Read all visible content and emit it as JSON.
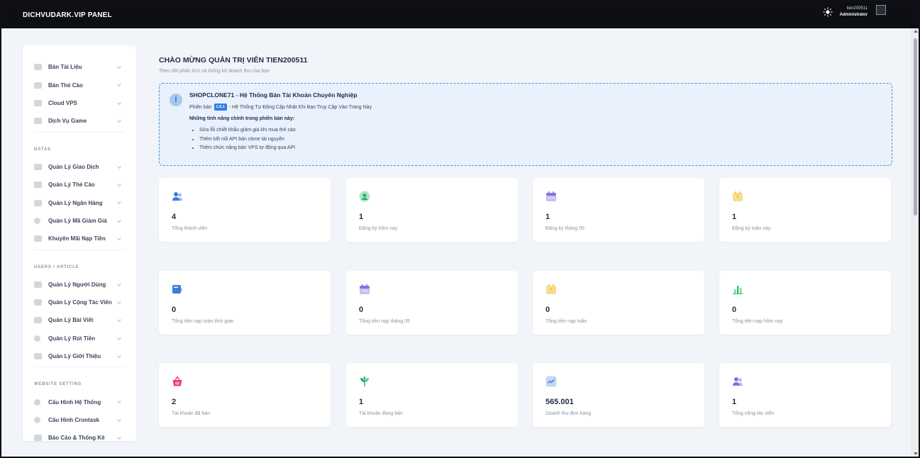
{
  "header": {
    "brand": "DICHVUDARK.VIP PANEL",
    "user_name": "tien200511",
    "user_role": "Administrator"
  },
  "sidebar": {
    "group1": [
      {
        "label": "Bán Tài Liệu",
        "icon": "document-icon"
      },
      {
        "label": "Bán Thẻ Cào",
        "icon": "card-icon"
      },
      {
        "label": "Cloud VPS",
        "icon": "cloud-icon"
      },
      {
        "label": "Dịch Vụ Game",
        "icon": "game-icon"
      }
    ],
    "section_data": "DATAS",
    "group2": [
      {
        "label": "Quản Lý Giao Dịch",
        "icon": "transaction-icon"
      },
      {
        "label": "Quản Lý Thẻ Cào",
        "icon": "card-icon"
      },
      {
        "label": "Quản Lý Ngân Hàng",
        "icon": "bank-icon"
      },
      {
        "label": "Quản Lý Mã Giảm Giá",
        "icon": "discount-icon"
      },
      {
        "label": "Khuyến Mãi Nạp Tiền",
        "icon": "promotion-icon"
      }
    ],
    "section_users": "USERS / ARTICLE",
    "group3": [
      {
        "label": "Quản Lý Người Dùng",
        "icon": "users-icon"
      },
      {
        "label": "Quản Lý Cộng Tác Viên",
        "icon": "partner-icon"
      },
      {
        "label": "Quản Lý Bài Viết",
        "icon": "article-icon"
      },
      {
        "label": "Quản Lý Rút Tiền",
        "icon": "withdraw-icon"
      },
      {
        "label": "Quản Lý Giới Thiệu",
        "icon": "referral-icon"
      }
    ],
    "section_website": "WEBSITE SETTING",
    "group4": [
      {
        "label": "Cấu Hình Hệ Thống",
        "icon": "settings-icon"
      },
      {
        "label": "Cấu Hình Crontask",
        "icon": "clock-icon"
      },
      {
        "label": "Báo Cáo & Thống Kê",
        "icon": "report-icon"
      }
    ]
  },
  "main": {
    "welcome_title": "CHÀO MỪNG QUẢN TRỊ VIÊN TIEN200511",
    "welcome_sub": "Theo dõi phân tích và thống kê doanh thu của bạn",
    "notice": {
      "title": "SHOPCLONE71 - Hệ Thống Bán Tài Khoản Chuyên Nghiệp",
      "version_prefix": "Phiên bản",
      "version": "1.6.1",
      "version_suffix": "- Hệ Thống Tự Động Cập Nhật Khi Bạn Truy Cập Vào Trang Này",
      "features_title": "Những tính năng chính trong phiên bản này:",
      "features": [
        "Sửa lỗi chiết khấu giảm giá khi mua thẻ cào",
        "Thêm kết nối API bán clone tài nguyên",
        "Thêm chức năng bán VPS tự động qua API"
      ]
    },
    "cards": [
      {
        "value": "4",
        "label": "Tổng thành viên",
        "icon": "users-icon",
        "color": "#3b7ddd"
      },
      {
        "value": "1",
        "label": "Đăng ký hôm nay",
        "icon": "user-icon",
        "color": "#1fb36b"
      },
      {
        "value": "1",
        "label": "Đăng ký tháng 05",
        "icon": "calendar-icon",
        "color": "#8b6fe0"
      },
      {
        "value": "1",
        "label": "Đăng ký tuần này",
        "icon": "calendar-week-icon",
        "color": "#f5c542"
      },
      {
        "value": "0",
        "label": "Tổng tiền nạp toàn thời gian",
        "icon": "wallet-icon",
        "color": "#3b7ddd"
      },
      {
        "value": "0",
        "label": "Tổng tiền nạp tháng 05",
        "icon": "calendar-icon",
        "color": "#8b6fe0"
      },
      {
        "value": "0",
        "label": "Tổng tiền nạp tuần",
        "icon": "calendar-week-icon",
        "color": "#f5c542"
      },
      {
        "value": "0",
        "label": "Tổng tiền nạp hôm nay",
        "icon": "chart-icon",
        "color": "#2bbf6a"
      },
      {
        "value": "2",
        "label": "Tài khoản đã bán",
        "icon": "basket-icon",
        "color": "#f0386b"
      },
      {
        "value": "1",
        "label": "Tài khoản đang bán",
        "icon": "plant-icon",
        "color": "#1fb36b"
      },
      {
        "value": "565.001",
        "label": "Doanh thu đơn hàng",
        "icon": "trend-icon",
        "color": "#3b7ddd"
      },
      {
        "value": "1",
        "label": "Tổng cộng tác viên",
        "icon": "partners-icon",
        "color": "#8b6fe0"
      }
    ]
  }
}
